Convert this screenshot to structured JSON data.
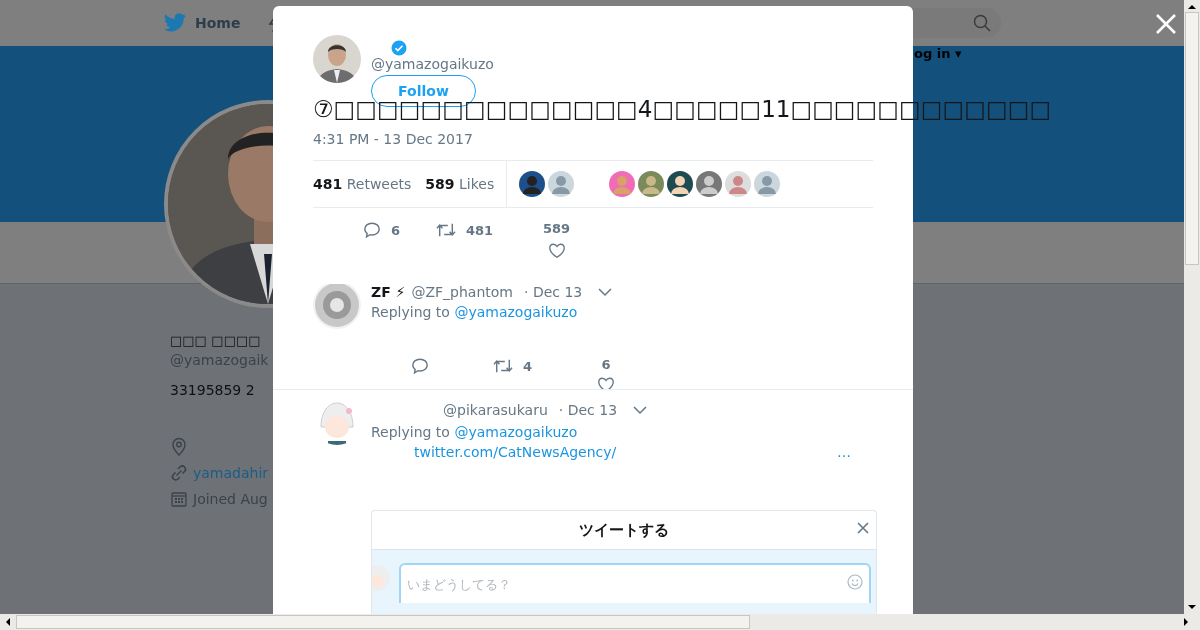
{
  "background_page": {
    "home_link": "Home",
    "login_link": "og in ▾",
    "profile": {
      "name": "□□□ □□□□",
      "handle": "@yamazogaik",
      "bio": "33195859 2",
      "website": "yamadahir",
      "joined": "Joined Aug"
    }
  },
  "tweet": {
    "handle": "@yamazogaikuzo",
    "verified": true,
    "follow_button": "Follow",
    "text": "⑦□□□□□□□□□□□□□□4□□□□□11□□□□□□□□□□□□",
    "timestamp": "4:31 PM - 13 Dec 2017",
    "retweets": {
      "count": "481",
      "label": "Retweets"
    },
    "likes": {
      "count": "589",
      "label": "Likes"
    },
    "actions": [
      {
        "kind": "reply",
        "count": "6"
      },
      {
        "kind": "retweet",
        "count": "481"
      },
      {
        "kind": "like",
        "count": "589"
      }
    ]
  },
  "replies": [
    {
      "name": "ZF ⚡",
      "handle": "@ZF_phantom",
      "date": "· Dec 13",
      "replying_label": "Replying to",
      "replying_to": "@yamazogaikuzo",
      "actions": [
        {
          "kind": "reply"
        },
        {
          "kind": "retweet",
          "count": "4"
        },
        {
          "kind": "like",
          "count": "6"
        }
      ]
    },
    {
      "handle": "@pikarasukaru",
      "date": "· Dec 13",
      "replying_label": "Replying to",
      "replying_to": "@yamazogaikuzo",
      "link": "twitter.com/CatNewsAgency/",
      "ellipsis": "…"
    }
  ],
  "compose": {
    "title": "ツイートする",
    "placeholder": "いまどうしてる？"
  }
}
